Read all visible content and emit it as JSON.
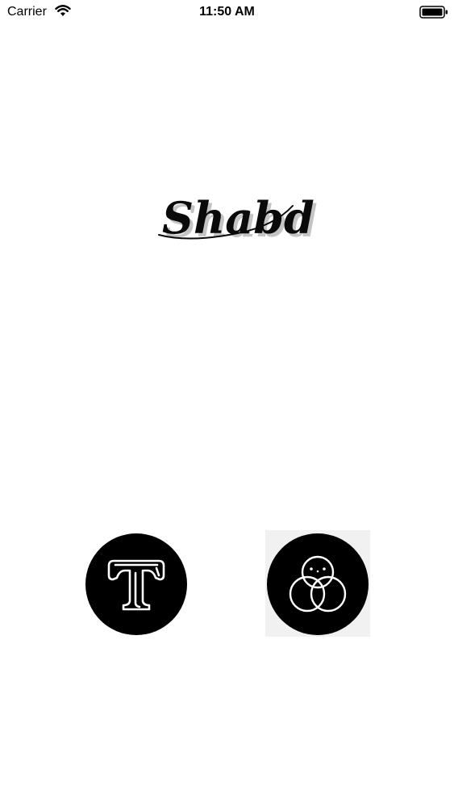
{
  "status_bar": {
    "carrier": "Carrier",
    "time": "11:50 AM",
    "wifi_icon": "wifi-icon",
    "battery_icon": "battery-icon"
  },
  "logo": {
    "text": "Shabd"
  },
  "buttons": {
    "text_mode_icon": "text-t-icon",
    "image_mode_icon": "overlapping-circles-face-icon"
  },
  "colors": {
    "background": "#ffffff",
    "button_fill": "#000000",
    "icon_stroke": "#ffffff"
  }
}
